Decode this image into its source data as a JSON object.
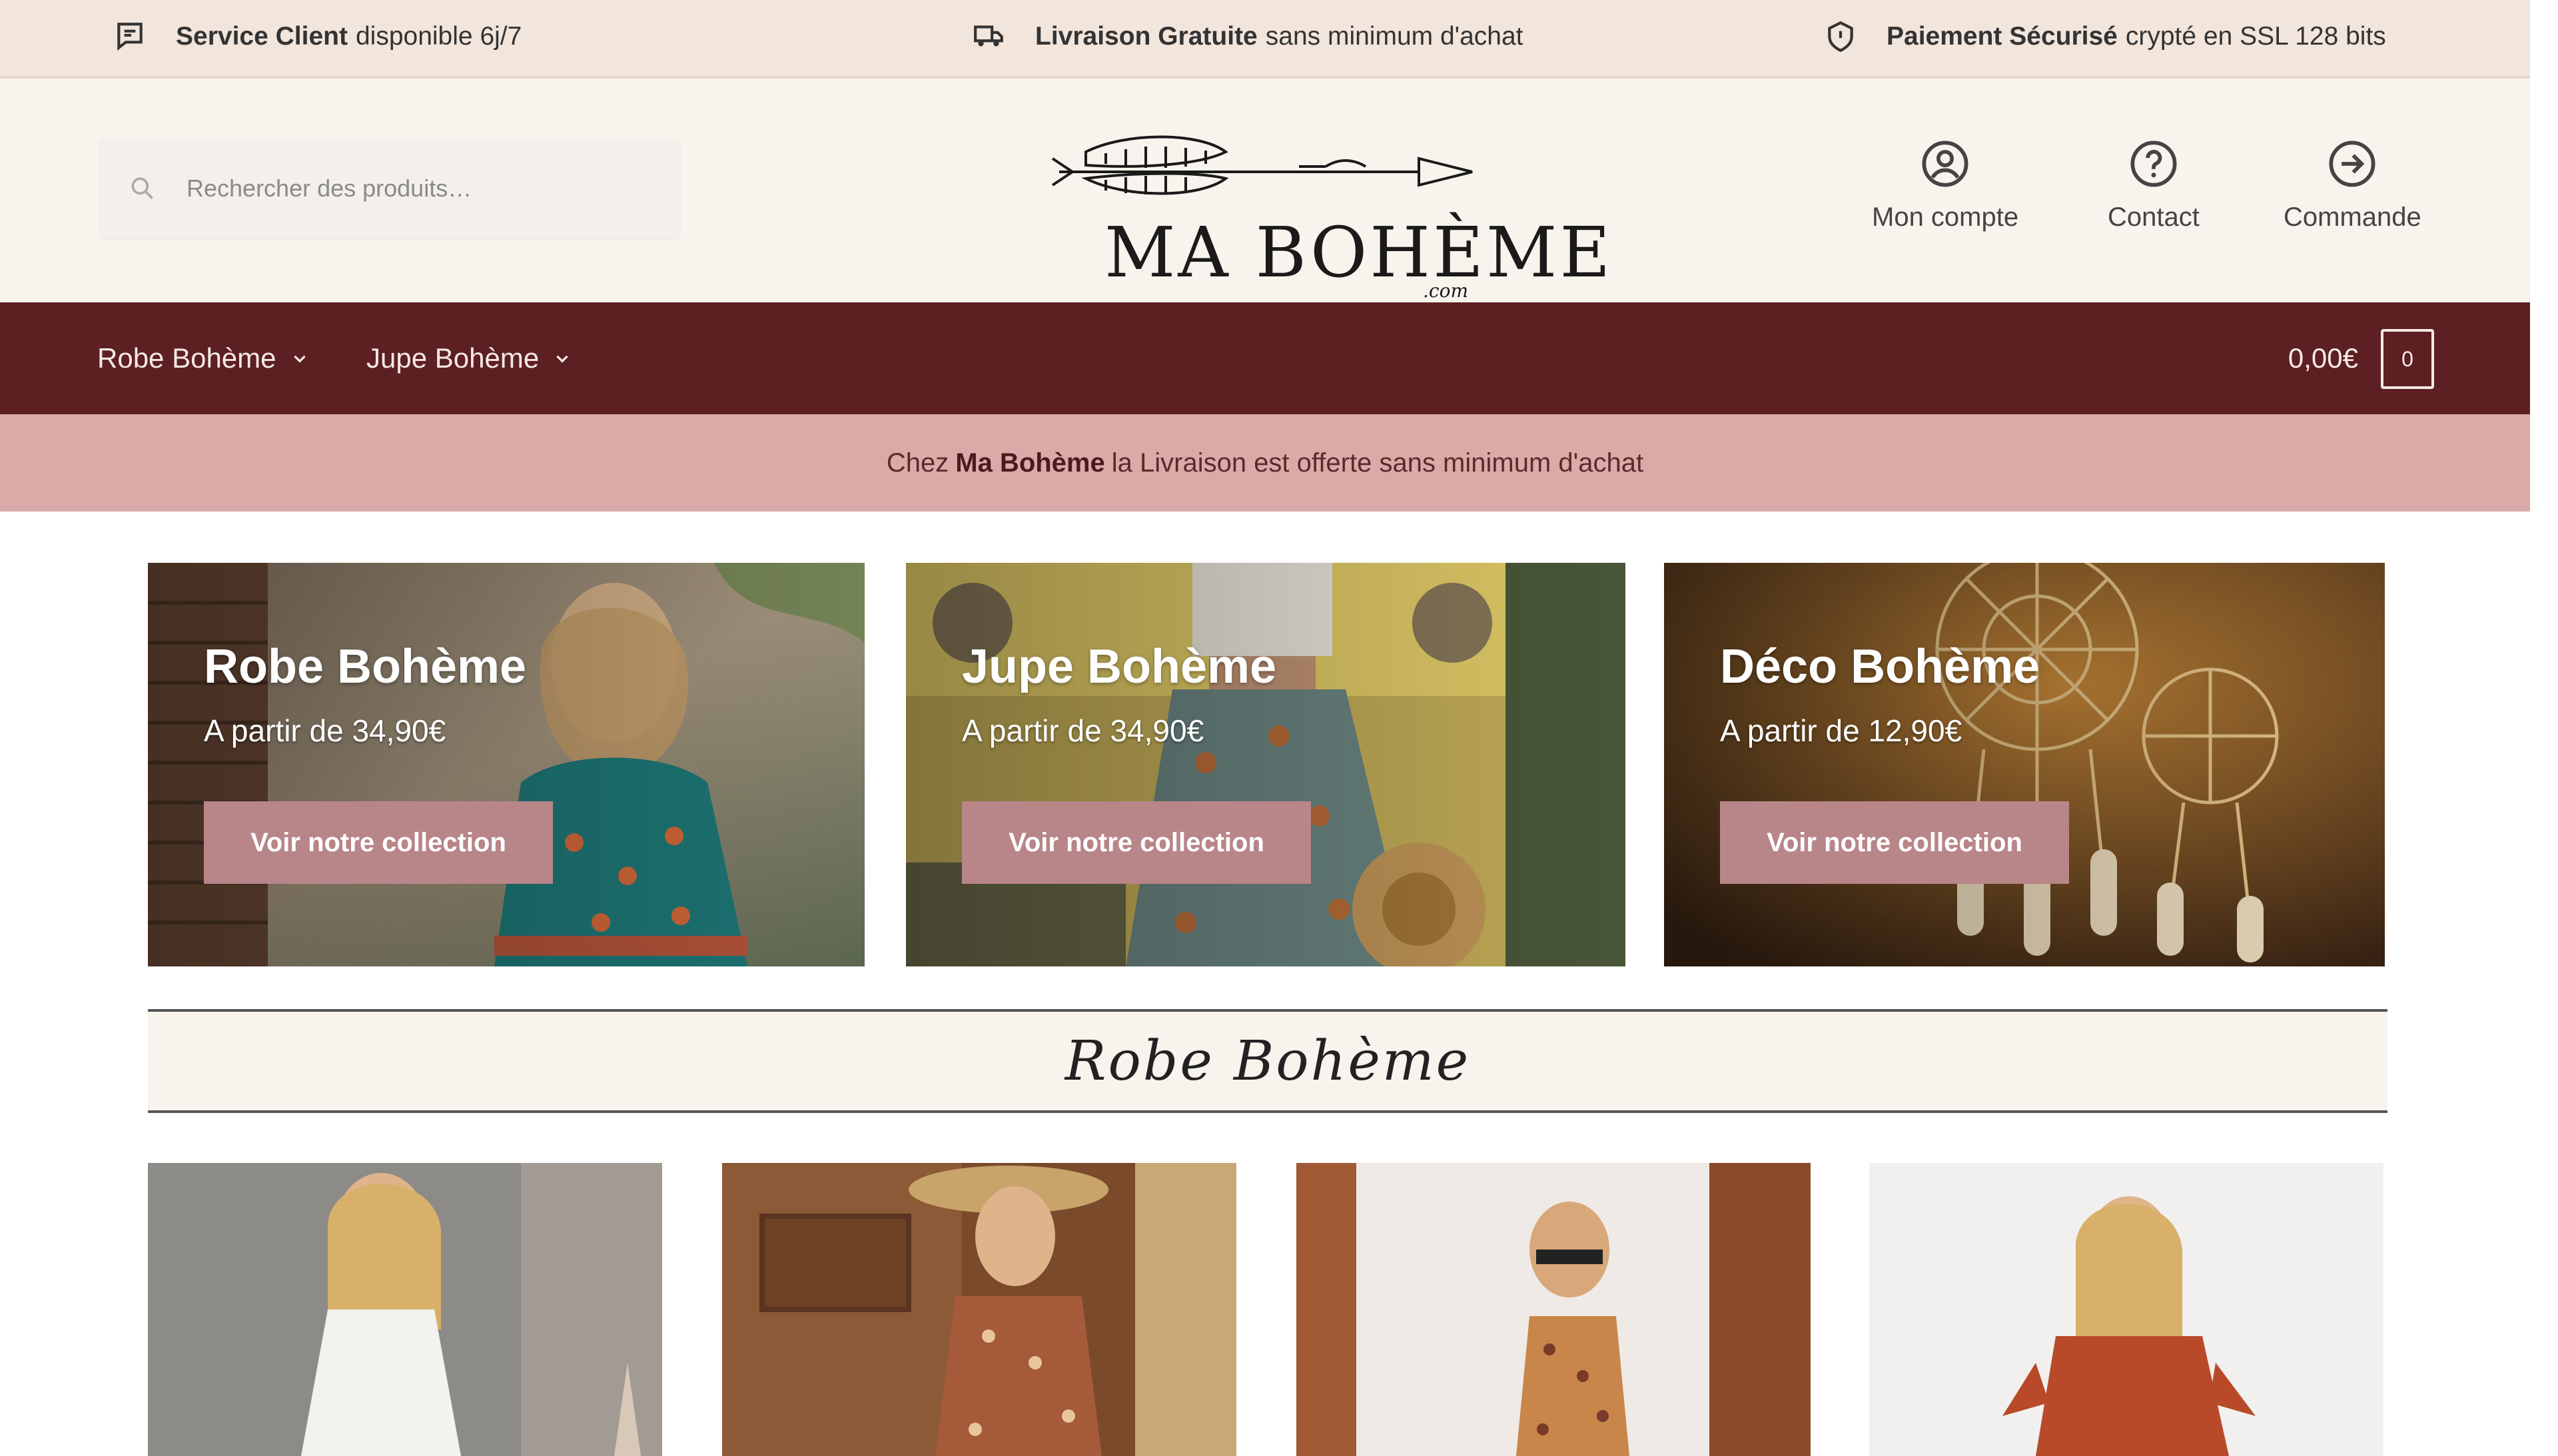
{
  "topbar": {
    "items": [
      {
        "icon": "chat-icon",
        "bold": "Service Client",
        "text": "disponible 6j/7"
      },
      {
        "icon": "truck-icon",
        "bold": "Livraison Gratuite",
        "text": "sans minimum d'achat"
      },
      {
        "icon": "shield-icon",
        "bold": "Paiement Sécurisé",
        "text": "crypté en SSL 128 bits"
      }
    ]
  },
  "header": {
    "search_placeholder": "Rechercher des produits…",
    "logo_text": "MA BOHÈME",
    "logo_sub": ".com",
    "links": [
      {
        "icon": "user-icon",
        "label": "Mon compte"
      },
      {
        "icon": "help-icon",
        "label": "Contact"
      },
      {
        "icon": "arrow-right-icon",
        "label": "Commande"
      }
    ]
  },
  "nav": {
    "items": [
      {
        "label": "Robe Bohème"
      },
      {
        "label": "Jupe Bohème"
      }
    ],
    "cart_total": "0,00€",
    "cart_count": "0"
  },
  "promo": {
    "prefix": "Chez",
    "brand": "Ma Bohème",
    "suffix": "la Livraison est offerte sans minimum d'achat"
  },
  "banners": [
    {
      "title": "Robe Bohème",
      "price": "A partir de 34,90€",
      "button": "Voir notre collection"
    },
    {
      "title": "Jupe Bohème",
      "price": "A partir de 34,90€",
      "button": "Voir notre collection"
    },
    {
      "title": "Déco Bohème",
      "price": "A partir de 12,90€",
      "button": "Voir notre collection"
    }
  ],
  "section": {
    "title": "Robe Bohème"
  },
  "colors": {
    "topbar_bg": "#f2e5dc",
    "header_bg": "#f8f3ed",
    "nav_bg": "#5c1f22",
    "promo_bg": "#d9aaa7",
    "button_bg": "#b88588"
  }
}
